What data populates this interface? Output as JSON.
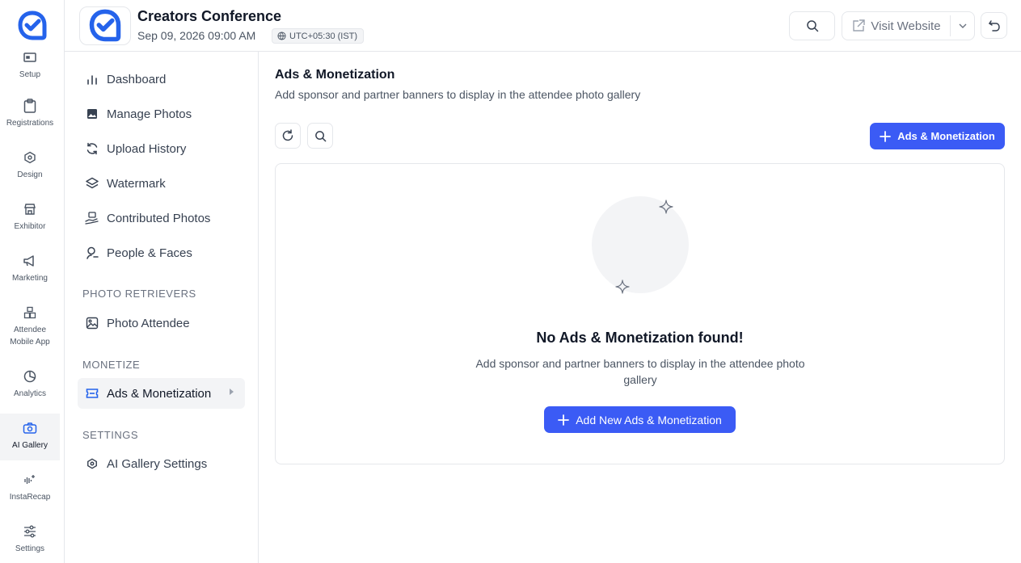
{
  "colors": {
    "accent": "#3b5bf5",
    "logo": "#2563eb"
  },
  "rail": {
    "items": [
      {
        "label": "Setup",
        "icon": "setup-icon"
      },
      {
        "label": "Registrations",
        "icon": "clipboard-icon"
      },
      {
        "label": "Design",
        "icon": "hexagon-icon"
      },
      {
        "label": "Exhibitor",
        "icon": "store-icon"
      },
      {
        "label": "Marketing",
        "icon": "megaphone-icon"
      },
      {
        "label": "Attendee Mobile App",
        "icon": "boxes-icon"
      },
      {
        "label": "Analytics",
        "icon": "pie-chart-icon"
      },
      {
        "label": "AI Gallery",
        "icon": "camera-sparkle-icon",
        "active": true
      },
      {
        "label": "InstaRecap",
        "icon": "waveform-icon"
      },
      {
        "label": "Settings",
        "icon": "sliders-icon"
      }
    ]
  },
  "header": {
    "event_title": "Creators Conference",
    "event_date": "Sep 09, 2026 09:00 AM",
    "timezone": "UTC+05:30 (IST)",
    "visit_label": "Visit Website"
  },
  "sidebar": {
    "items": [
      {
        "label": "Dashboard",
        "icon": "bar-chart-icon"
      },
      {
        "label": "Manage Photos",
        "icon": "image-icon"
      },
      {
        "label": "Upload History",
        "icon": "refresh-icon"
      },
      {
        "label": "Watermark",
        "icon": "layers-icon"
      },
      {
        "label": "Contributed Photos",
        "icon": "hand-photo-icon"
      },
      {
        "label": "People & Faces",
        "icon": "face-scan-icon"
      }
    ],
    "sections": {
      "retrievers": {
        "title": "PHOTO RETRIEVERS",
        "items": [
          {
            "label": "Photo Attendee",
            "icon": "photo-icon"
          }
        ]
      },
      "monetize": {
        "title": "MONETIZE",
        "items": [
          {
            "label": "Ads & Monetization",
            "icon": "ticket-icon",
            "active": true
          }
        ]
      },
      "settings": {
        "title": "SETTINGS",
        "items": [
          {
            "label": "AI Gallery Settings",
            "icon": "hexagon-settings-icon"
          }
        ]
      }
    }
  },
  "main": {
    "title": "Ads & Monetization",
    "subtitle": "Add sponsor and partner banners to display in the attendee photo gallery",
    "add_button": "Ads & Monetization",
    "empty": {
      "title": "No Ads & Monetization found!",
      "description": "Add sponsor and partner banners to display in the attendee photo gallery",
      "button": "Add New Ads & Monetization"
    }
  }
}
